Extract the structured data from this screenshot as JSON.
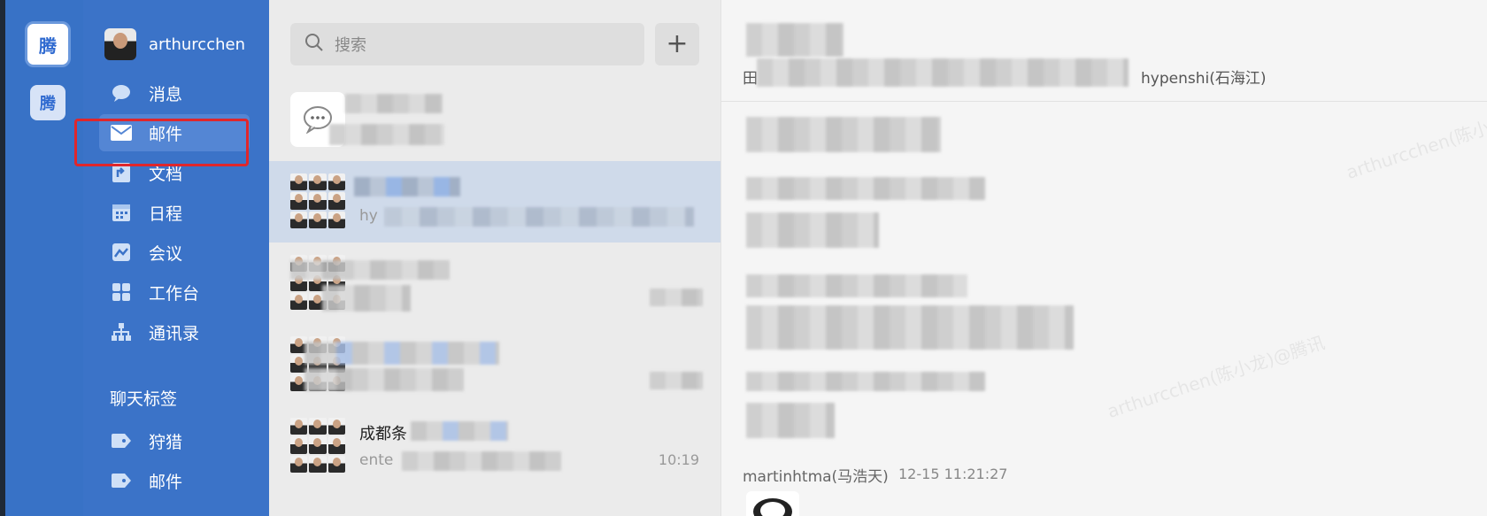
{
  "rail": {
    "logo_text": "腾",
    "logo2_text": "腾"
  },
  "profile": {
    "name": "arthurcchen"
  },
  "nav": {
    "items": [
      {
        "label": "消息",
        "icon": "chat-bubble-icon"
      },
      {
        "label": "邮件",
        "icon": "mail-icon",
        "active": true
      },
      {
        "label": "文档",
        "icon": "document-icon"
      },
      {
        "label": "日程",
        "icon": "calendar-icon"
      },
      {
        "label": "会议",
        "icon": "meeting-icon"
      },
      {
        "label": "工作台",
        "icon": "workbench-icon"
      },
      {
        "label": "通讯录",
        "icon": "org-chart-icon"
      }
    ],
    "section_title": "聊天标签",
    "tags": [
      {
        "label": "狩猎",
        "icon": "tag-icon"
      },
      {
        "label": "邮件",
        "icon": "tag-icon"
      }
    ]
  },
  "search": {
    "placeholder": "搜索"
  },
  "list": {
    "chats": [
      {
        "title": "",
        "subtitle": "",
        "time": ""
      },
      {
        "title": "",
        "subtitle": "hy",
        "time": ""
      },
      {
        "title": "",
        "subtitle": "",
        "time": ""
      },
      {
        "title": "",
        "subtitle": "",
        "time": ""
      },
      {
        "title": "成都条",
        "subtitle": "ente",
        "time": "10:19"
      }
    ]
  },
  "pane": {
    "subtitle_prefix": "田",
    "member_name": "hypenshi(石海江)",
    "last_sender": "martinhtma(马浩天)",
    "last_time": "12-15 11:21:27",
    "watermark": "arthurcchen(陈小龙)@腾讯"
  },
  "colors": {
    "rail": "#3872c6",
    "nav": "#3b73c8",
    "highlight": "#e0262b"
  }
}
